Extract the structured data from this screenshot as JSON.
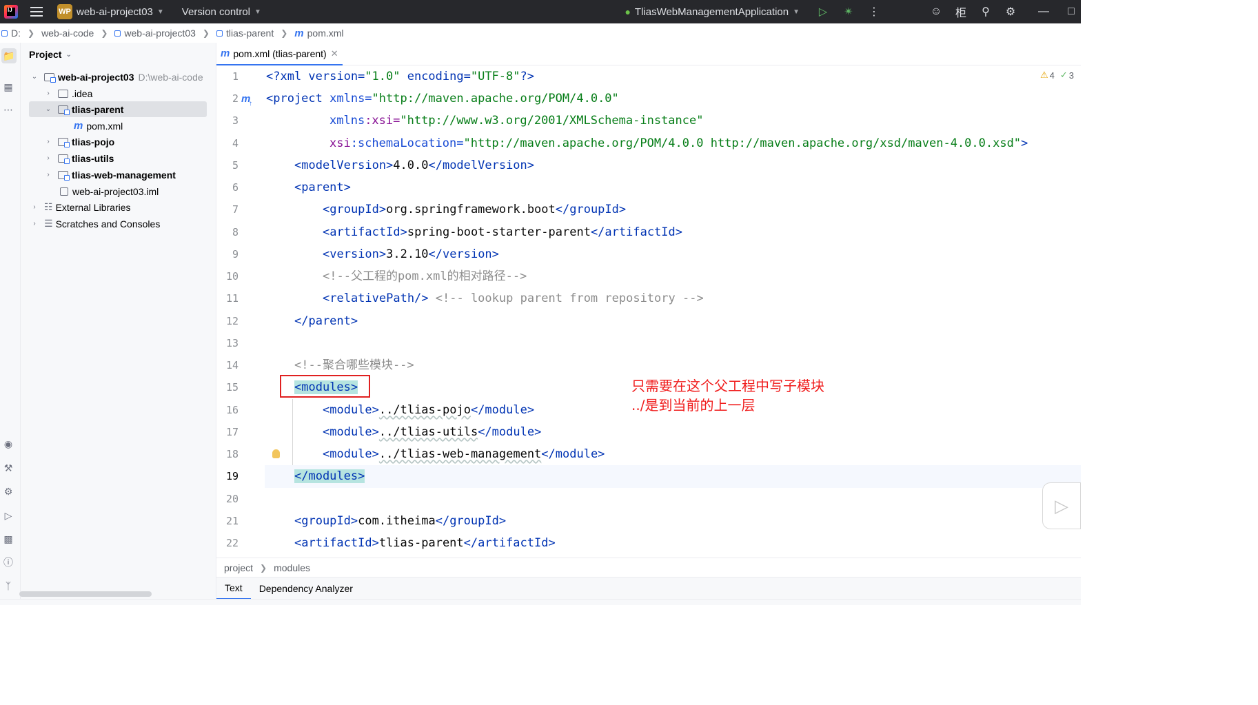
{
  "titlebar": {
    "project_badge": "WP",
    "project_name": "web-ai-project03",
    "vcs_label": "Version control",
    "run_config": "TliasWebManagementApplication"
  },
  "breadcrumbs": [
    "D:",
    "web-ai-code",
    "web-ai-project03",
    "tlias-parent",
    "pom.xml"
  ],
  "project_panel": {
    "title": "Project",
    "root_name": "web-ai-project03",
    "root_path": "D:\\web-ai-code",
    "items": [
      ".idea",
      "tlias-parent",
      "pom.xml",
      "tlias-pojo",
      "tlias-utils",
      "tlias-web-management",
      "web-ai-project03.iml",
      "External Libraries",
      "Scratches and Consoles"
    ]
  },
  "editor": {
    "tab_label": "pom.xml (tlias-parent)",
    "warnings_count": "4",
    "checks_count": "3",
    "line_numbers": [
      "1",
      "2",
      "3",
      "4",
      "5",
      "6",
      "7",
      "8",
      "9",
      "10",
      "11",
      "12",
      "13",
      "14",
      "15",
      "16",
      "17",
      "18",
      "19",
      "20",
      "21",
      "22"
    ],
    "annotation_line1": "只需要在这个父工程中写子模块",
    "annotation_line2": "../是到当前的上一层"
  },
  "code_tokens": {
    "l1": [
      "<?xml version=",
      "\"1.0\"",
      " encoding=",
      "\"UTF-8\"",
      "?>"
    ],
    "l2": [
      "<project",
      " xmlns=",
      "\"http://maven.apache.org/POM/4.0.0\""
    ],
    "l3": [
      "xmlns",
      ":xsi=",
      "\"http://www.w3.org/2001/XMLSchema-instance\""
    ],
    "l4": [
      "xsi",
      ":schemaLocation=",
      "\"http://maven.apache.org/POM/4.0.0 http://maven.apache.org/xsd/maven-4.0.0.xsd\"",
      ">"
    ],
    "l5": [
      "<modelVersion>",
      "4.0.0",
      "</modelVersion>"
    ],
    "l6": [
      "<parent>"
    ],
    "l7": [
      "<groupId>",
      "org.springframework.boot",
      "</groupId>"
    ],
    "l8": [
      "<artifactId>",
      "spring-boot-starter-parent",
      "</artifactId>"
    ],
    "l9": [
      "<version>",
      "3.2.10",
      "</version>"
    ],
    "l10": "<!--父工程的pom.xml的相对路径-->",
    "l11": [
      "<relativePath/>",
      " <!-- lookup parent from repository -->"
    ],
    "l12": "</parent>",
    "l14": "<!--聚合哪些模块-->",
    "l15": "<modules>",
    "l16": [
      "<module>",
      "../tlias-pojo",
      "</module>"
    ],
    "l17": [
      "<module>",
      "../tlias-utils",
      "</module>"
    ],
    "l18": [
      "<module>",
      "../tlias-web-management",
      "</module>"
    ],
    "l19": "</modules>",
    "l21": [
      "<groupId>",
      "com.itheima",
      "</groupId>"
    ],
    "l22": [
      "<artifactId>",
      "tlias-parent",
      "</artifactId>"
    ]
  },
  "bottom": {
    "crumb1": "project",
    "crumb2": "modules",
    "tab_text": "Text",
    "tab_dep": "Dependency Analyzer"
  },
  "colors": {
    "tag": "#0033b3",
    "string": "#067d17",
    "comment": "#8c8c8c",
    "annotation": "#f01d1d",
    "accent": "#3574f0"
  }
}
